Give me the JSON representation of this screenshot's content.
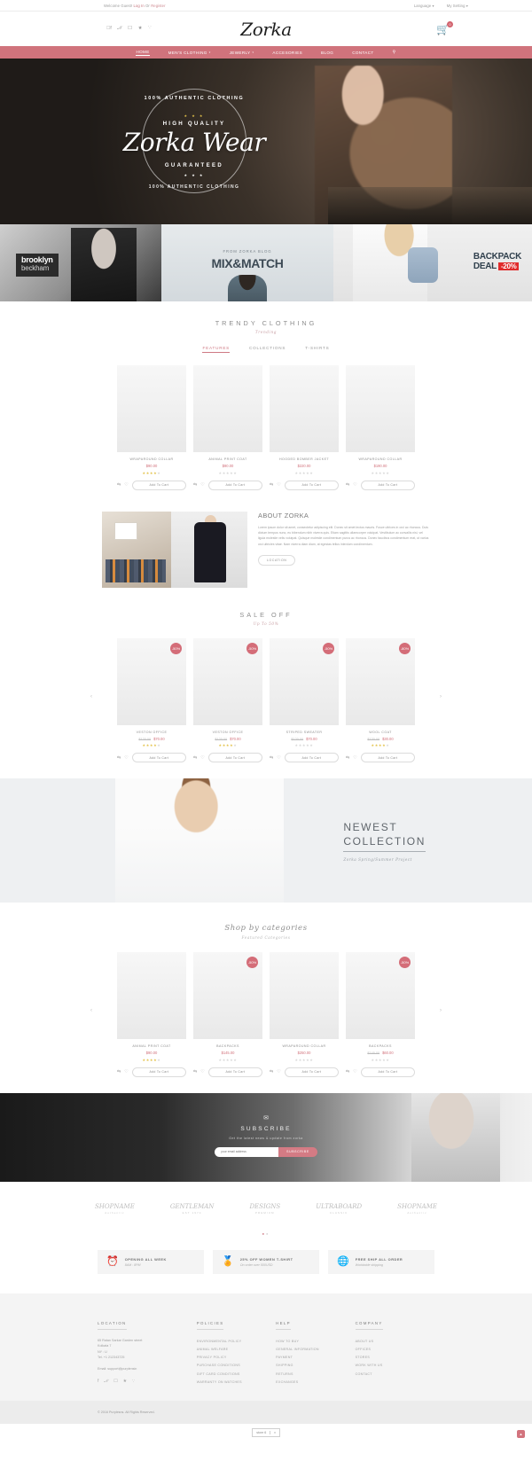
{
  "topbar": {
    "welcome": "Welcome Guest!",
    "login": "Log In",
    "or": "Or",
    "register": "Register",
    "language": "Language",
    "setting": "My Setting"
  },
  "header": {
    "brand": "Zorka",
    "social": [
      "facebook-icon",
      "twitter-icon",
      "instagram-icon",
      "vk-icon",
      "behance-icon"
    ],
    "cart_count": "0"
  },
  "nav": {
    "items": [
      {
        "label": "HOME",
        "caret": false,
        "active": true
      },
      {
        "label": "MEN'S CLOTHING",
        "caret": true,
        "active": false
      },
      {
        "label": "JEWERLY",
        "caret": true,
        "active": false
      },
      {
        "label": "ACCESORIES",
        "caret": false,
        "active": false
      },
      {
        "label": "BLOG",
        "caret": false,
        "active": false
      },
      {
        "label": "CONTACT",
        "caret": false,
        "active": false
      }
    ],
    "search": "search-icon"
  },
  "hero": {
    "arc_top": "100% AUTHENTIC CLOTHING",
    "stars": "★ ★ ★",
    "high_quality": "HIGH QUALITY",
    "title": "Zorka Wear",
    "guaranteed": "GUARANTEED",
    "arc_bottom": "100% AUTHENTIC CLOTHING"
  },
  "promos": [
    {
      "line1": "brooklyn",
      "line2": "beckham"
    },
    {
      "small": "FROM ZORKA BLOG",
      "big": "MIX&MATCH"
    },
    {
      "line1": "BACKPACK",
      "line2": "DEAL",
      "pct": "-20%"
    }
  ],
  "trendy": {
    "title": "TRENDY CLOTHING",
    "subtitle": "Trending",
    "tabs": [
      {
        "label": "FEATURES",
        "active": true
      },
      {
        "label": "COLLECTIONS",
        "active": false
      },
      {
        "label": "T-SHIRTS",
        "active": false
      }
    ],
    "products": [
      {
        "name": "WRAPAROUND COLLAR",
        "price": "$90.00",
        "old": "",
        "stars": 4,
        "cta": "Add To Cart"
      },
      {
        "name": "ANIMAL PRINT COAT",
        "price": "$90.00",
        "old": "",
        "stars": 0,
        "cta": "Add To Cart"
      },
      {
        "name": "HOODED BOMBER JACKET",
        "price": "$220.00",
        "old": "",
        "stars": 0,
        "cta": "Add To Cart"
      },
      {
        "name": "WRAPAROUND COLLAR",
        "price": "$190.00",
        "old": "",
        "stars": 0,
        "cta": "Add To Cart"
      }
    ]
  },
  "about": {
    "title": "ABOUT ZORKA",
    "body": "Lorem ipsum dolor sit amet, consectetur adipiscing elit. Donec sit amet lectus mauris. Fusce ultrices in orci ac rhoncus. Duis dictum tempus nunc, eu bibendum nibh viverra quis. Etiam sagittis ullamcorper volutpat. Vestibulum ac convallis nisi, vel ligula molestie velis volutpat. Quisque molestie condimentum purus ac rhoncus. Donec faucibus condimentum erat, ut varius orci ultricies vitae. Nam viverra diam diam, at egestas tellus interdum condimentum.",
    "button": "LOCATION"
  },
  "saleoff": {
    "title": "SALE OFF",
    "subtitle": "Up To 50%",
    "products": [
      {
        "name": "VESTON OFFICE",
        "price": "$70.00",
        "old": "$120.00",
        "badge": "-50%",
        "stars": 4,
        "cta": "Add To Cart"
      },
      {
        "name": "VESTON OFFICE",
        "price": "$70.00",
        "old": "$120.00",
        "badge": "-50%",
        "stars": 4,
        "cta": "Add To Cart"
      },
      {
        "name": "STRIPED SWEATER",
        "price": "$70.00",
        "old": "$120.00",
        "badge": "-50%",
        "stars": 0,
        "cta": "Add To Cart"
      },
      {
        "name": "WOOL COAT",
        "price": "$30.00",
        "old": "$130.00",
        "badge": "-80%",
        "stars": 4,
        "cta": "Add To Cart"
      }
    ]
  },
  "newest": {
    "line1": "NEWEST",
    "line2": "COLLECTION",
    "line3": "Zorka Spring/Summer Project"
  },
  "categories": {
    "title": "Shop by categories",
    "subtitle": "Featured Categories",
    "products": [
      {
        "name": "ANIMAL PRINT COAT",
        "price": "$90.00",
        "old": "",
        "badge": "",
        "stars": 4,
        "cta": "Add To Cart"
      },
      {
        "name": "BACKPACKS",
        "price": "$145.00",
        "old": "",
        "badge": "-50%",
        "stars": 0,
        "cta": "Add To Cart"
      },
      {
        "name": "WRAPAROUND COLLAR",
        "price": "$250.00",
        "old": "",
        "badge": "",
        "stars": 0,
        "cta": "Add To Cart"
      },
      {
        "name": "BACKPACKS",
        "price": "$60.00",
        "old": "$145.00",
        "badge": "-50%",
        "stars": 0,
        "cta": "Add To Cart"
      }
    ]
  },
  "subscribe": {
    "icon": "envelope-icon",
    "title": "SUBSCRIBE",
    "desc": "Get the latest news & update from zorka",
    "placeholder": "your email address",
    "button": "SUBSCRIBE"
  },
  "brands": [
    {
      "name": "SHOPNAME",
      "sub": "Authentic"
    },
    {
      "name": "GENTLEMAN",
      "sub": "EST 1974"
    },
    {
      "name": "DESIGNS",
      "sub": "PREMIUM"
    },
    {
      "name": "ULTRABOARD",
      "sub": "CLASSIC"
    },
    {
      "name": "SHOPNAME",
      "sub": "Authentic"
    }
  ],
  "features": [
    {
      "icon": "alarm-clock-icon",
      "title": "OPENING ALL WEEK",
      "desc": "8AM : 8PM"
    },
    {
      "icon": "medal-icon",
      "title": "25% OFF WOMEN T-SHIRT",
      "desc": "On order over 500USD"
    },
    {
      "icon": "globe-icon",
      "title": "FREE SHIP ALL ORDER",
      "desc": "Worldwide shipping"
    }
  ],
  "footer": {
    "location": {
      "heading": "LOCATION",
      "address": "65 Ratan Sarkar Garden street\nKolkata 7\nNY : U\nTel. +1 212343725",
      "email": "Email: support@purplensin",
      "social": [
        "facebook-icon",
        "twitter-icon",
        "instagram-icon",
        "vk-icon",
        "behance-icon"
      ]
    },
    "policies": {
      "heading": "POLICIES",
      "items": [
        "ENVIRONMENTAL POLICY",
        "ANIMAL WELFARE",
        "PRIVACY POLICY",
        "PURCHASE CONDITIONS",
        "GIFT CARD CONDITIONS",
        "WARRANTY ON WATCHES"
      ]
    },
    "help": {
      "heading": "HELP",
      "items": [
        "HOW TO BUY",
        "GENERAL INFORMATION",
        "PAYMENT",
        "SHIPPING",
        "RETURNS",
        "EXCHANGES"
      ]
    },
    "company": {
      "heading": "COMPANY",
      "items": [
        "ABOUT US",
        "OFFICES",
        "STORES",
        "WORK WITH US",
        "CONTACT"
      ]
    }
  },
  "copy": "© 2016 Purplesns. All Rights Reserved.",
  "storebar": {
    "label": "store 6",
    "caret": "▾",
    "totop": "▲"
  }
}
